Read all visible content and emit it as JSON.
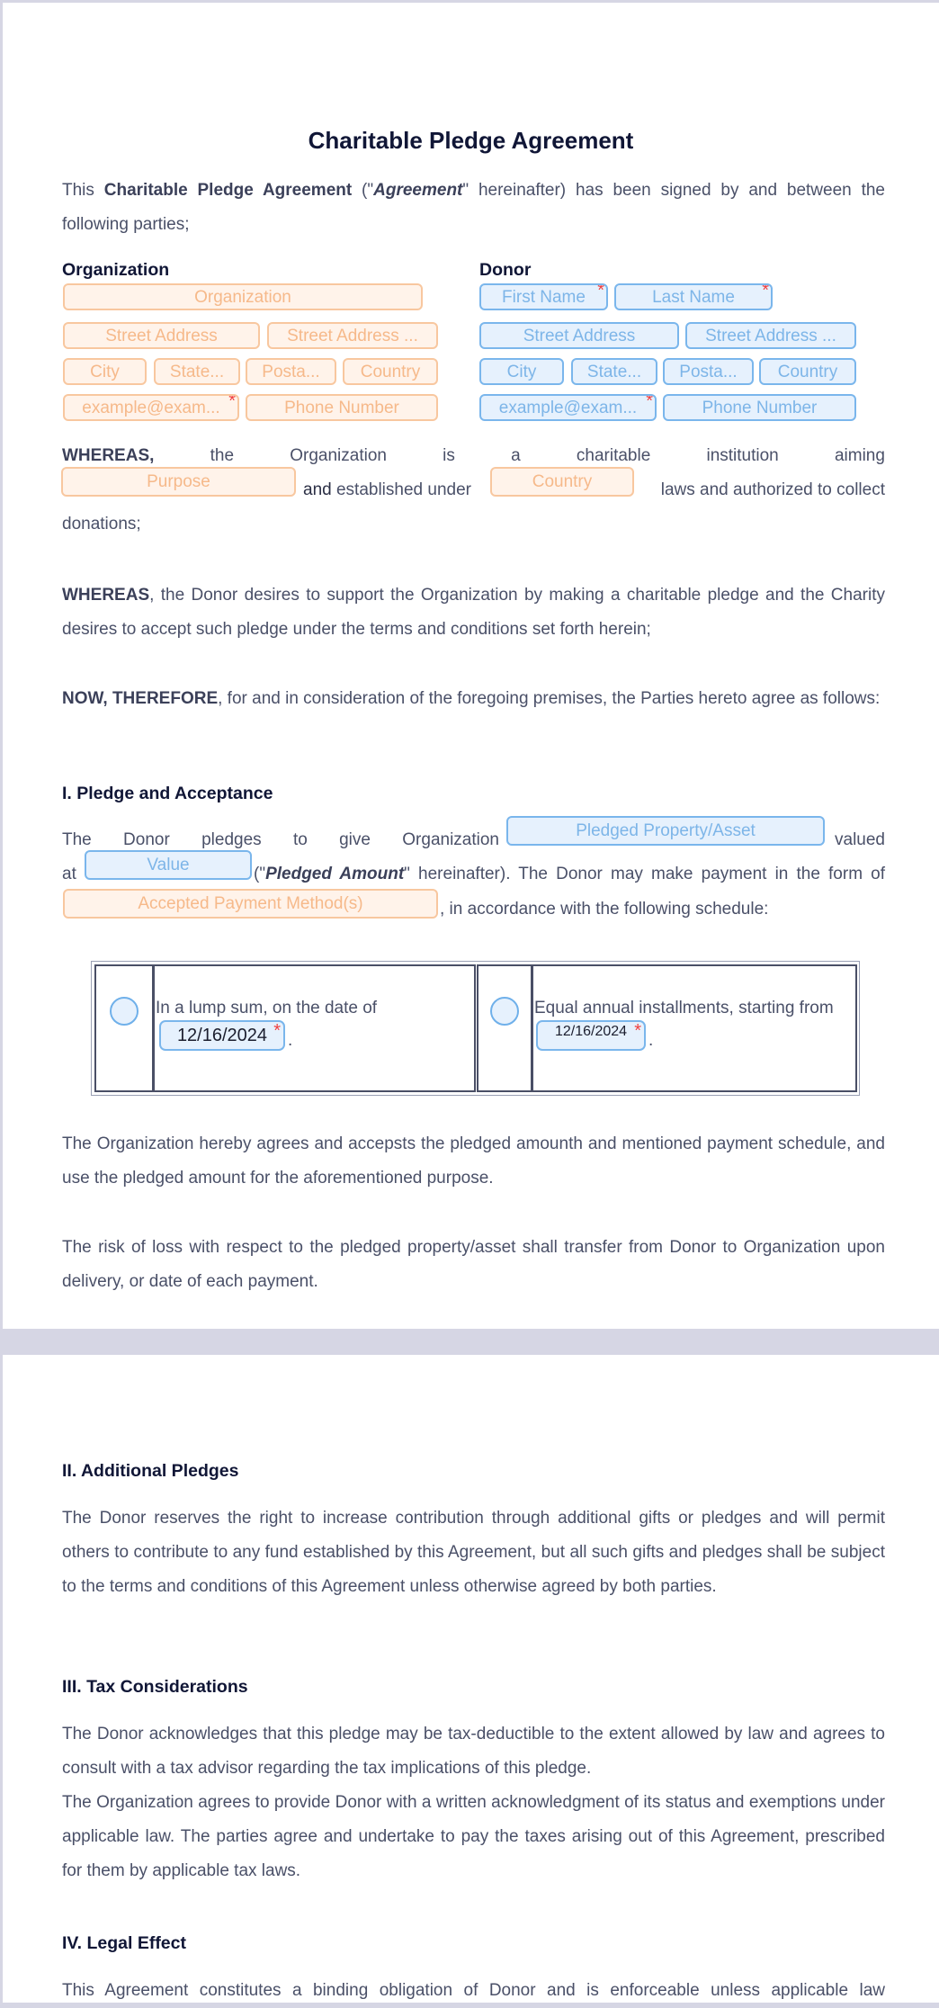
{
  "document": {
    "title": "Charitable Pledge Agreement",
    "intro": {
      "pre": "This ",
      "bold": "Charitable Pledge Agreement",
      "mid": " (\"",
      "italic": "Agreement",
      "post": "\" hereinafter) has been signed by and between the following parties;"
    },
    "parties": {
      "organization": {
        "label": "Organization",
        "fields": {
          "name": "Organization",
          "street": "Street Address",
          "street2": "Street Address ...",
          "city": "City",
          "state": "State...",
          "postal": "Posta...",
          "country": "Country",
          "email": "example@exam...",
          "phone": "Phone Number"
        }
      },
      "donor": {
        "label": "Donor",
        "fields": {
          "first_name": "First Name",
          "last_name": "Last Name",
          "street": "Street Address",
          "street2": "Street Address ...",
          "city": "City",
          "state": "State...",
          "postal": "Posta...",
          "country": "Country",
          "email": "example@exam...",
          "phone": "Phone Number"
        }
      },
      "required_mark": "*"
    },
    "whereas1": {
      "bold": "WHEREAS,",
      "words": [
        "the",
        "Organization",
        "is",
        "a",
        "charitable",
        "institution",
        "aiming"
      ],
      "purpose_field": "Purpose",
      "and": "and",
      "established": " established under",
      "country_field": "Country",
      "tail": "laws and authorized to collect",
      "end": "donations;"
    },
    "whereas2": {
      "bold": "WHEREAS",
      "text": ", the Donor desires to support the Organization by making a charitable pledge and the Charity desires to accept such pledge under the terms and conditions set forth herein;"
    },
    "now_therefore": {
      "bold": "NOW, THEREFORE",
      "text": ", for and in consideration of the foregoing premises, the Parties hereto agree as follows:"
    },
    "section1": {
      "heading": "I. Pledge and Acceptance",
      "line1_words": [
        "The",
        "Donor",
        "pledges",
        "to",
        "give",
        "Organization"
      ],
      "asset_field": "Pledged Property/Asset",
      "valued": "valued",
      "at": "at",
      "value_field": "Value",
      "amount_pre": "(\"",
      "amount_italic": "Pledged Amount",
      "amount_post": "\" hereinafter). The Donor may make payment in the form of",
      "payment_field": "Accepted Payment Method(s)",
      "schedule_text": ", in accordance with the following schedule:",
      "schedule": {
        "options": [
          {
            "label": "In a lump sum, on the date of",
            "date": "12/16/2024",
            "suffix": "."
          },
          {
            "label": "Equal annual installments, starting from",
            "date": "12/16/2024",
            "suffix": "."
          }
        ]
      },
      "acceptance": "The Organization hereby agrees and accepsts the pledged amounth and mentioned payment schedule, and use the pledged amount for the aforementioned purpose.",
      "risk": "The risk of loss with respect to the pledged property/asset shall transfer from Donor to Organization upon delivery, or date of each payment."
    },
    "section2": {
      "heading": "II. Additional Pledges",
      "text": "The Donor reserves the right to increase contribution through additional gifts or pledges and will permit others to contribute to any fund established by this Agreement, but all such gifts and pledges shall be subject to the terms and conditions of this Agreement unless otherwise agreed by both parties."
    },
    "section3": {
      "heading": "III. Tax Considerations",
      "text1": "The Donor acknowledges that this pledge may be tax-deductible to the extent allowed by law and agrees to consult with a tax advisor regarding the tax implications of this pledge.",
      "text2": "The Organization agrees to provide Donor with a written acknowledgment of its status and exemptions under applicable law. The parties agree and undertake to pay the taxes arising out of this Agreement, prescribed for them by applicable tax laws."
    },
    "section4": {
      "heading": "IV. Legal Effect",
      "text": "This Agreement constitutes a binding obligation of Donor and is enforceable unless applicable law"
    }
  },
  "colors": {
    "organization_field_bg": "#fff3ea",
    "organization_field_border": "#f8c79f",
    "donor_field_bg": "#e6f1fd",
    "donor_field_border": "#7ab6ec",
    "required": "#f04040",
    "heading": "#101636",
    "body_text": "#4a5068",
    "page_gap": "#d6d6e4"
  }
}
